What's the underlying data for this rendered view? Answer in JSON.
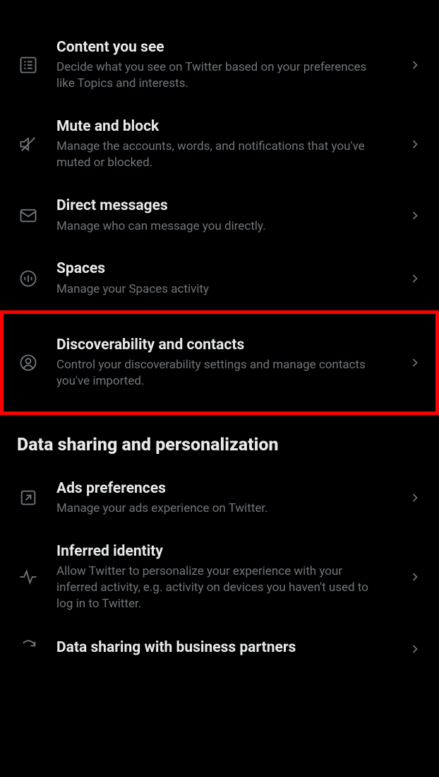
{
  "settings": {
    "items": [
      {
        "title": "Content you see",
        "subtitle": "Decide what you see on Twitter based on your preferences like Topics and interests."
      },
      {
        "title": "Mute and block",
        "subtitle": "Manage the accounts, words, and notifications that you've muted or blocked."
      },
      {
        "title": "Direct messages",
        "subtitle": "Manage who can message you directly."
      },
      {
        "title": "Spaces",
        "subtitle": "Manage your Spaces activity"
      },
      {
        "title": "Discoverability and contacts",
        "subtitle": "Control your discoverability settings and manage contacts you've imported.",
        "highlighted": true
      }
    ],
    "section2_header": "Data sharing and personalization",
    "items2": [
      {
        "title": "Ads preferences",
        "subtitle": "Manage your ads experience on Twitter."
      },
      {
        "title": "Inferred identity",
        "subtitle": "Allow Twitter to personalize your experience with your inferred activity, e.g. activity on devices you haven't used to log in to Twitter."
      },
      {
        "title": "Data sharing with business partners",
        "subtitle": ""
      }
    ]
  }
}
